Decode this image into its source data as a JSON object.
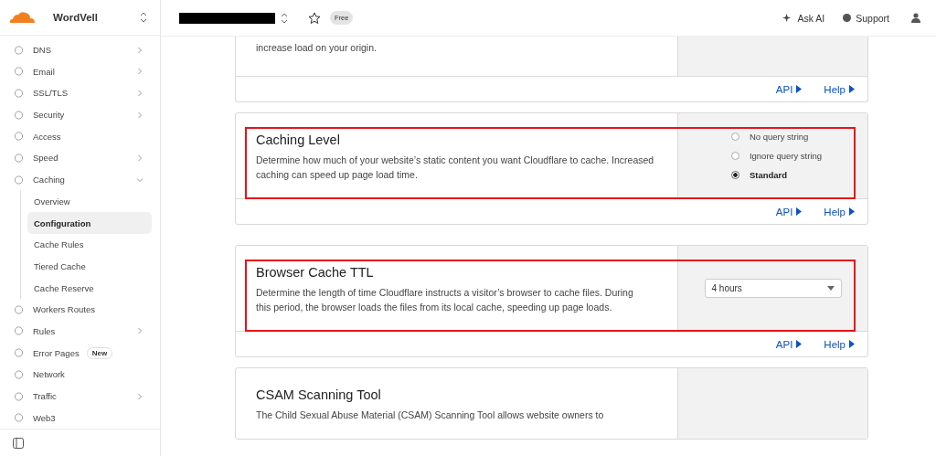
{
  "sidebar": {
    "account": "WordVell",
    "items": [
      {
        "label": "DNS",
        "expanded": false
      },
      {
        "label": "Email",
        "expanded": false
      },
      {
        "label": "SSL/TLS",
        "expanded": false
      },
      {
        "label": "Security",
        "expanded": false
      },
      {
        "label": "Access"
      },
      {
        "label": "Speed",
        "expanded": false
      },
      {
        "label": "Caching",
        "expanded": true,
        "children": [
          {
            "label": "Overview",
            "selected": false
          },
          {
            "label": "Configuration",
            "selected": true
          },
          {
            "label": "Cache Rules",
            "selected": false
          },
          {
            "label": "Tiered Cache",
            "selected": false
          },
          {
            "label": "Cache Reserve",
            "selected": false
          }
        ]
      },
      {
        "label": "Workers Routes"
      },
      {
        "label": "Rules",
        "expanded": false
      },
      {
        "label": "Error Pages",
        "badge": "New"
      },
      {
        "label": "Network"
      },
      {
        "label": "Traffic",
        "expanded": false
      },
      {
        "label": "Web3"
      }
    ]
  },
  "header": {
    "plan": "Free",
    "ask_ai": "Ask AI",
    "support": "Support"
  },
  "cards": [
    {
      "kind": "partial",
      "description": "increase load on your origin.",
      "highlighted": false,
      "links": [
        "API",
        "Help"
      ]
    },
    {
      "kind": "radio",
      "title": "Caching Level",
      "description": "Determine how much of your website’s static content you want Cloudflare to cache. Increased caching can speed up page load time.",
      "highlighted": true,
      "options": [
        {
          "label": "No query string",
          "selected": false
        },
        {
          "label": "Ignore query string",
          "selected": false
        },
        {
          "label": "Standard",
          "selected": true
        }
      ],
      "links": [
        "API",
        "Help"
      ]
    },
    {
      "kind": "select",
      "title": "Browser Cache TTL",
      "description": "Determine the length of time Cloudflare instructs a visitor’s browser to cache files. During this period, the browser loads the files from its local cache, speeding up page loads.",
      "highlighted": true,
      "value": "4 hours",
      "links": [
        "API",
        "Help"
      ]
    },
    {
      "kind": "cut",
      "title": "CSAM Scanning Tool",
      "description": "The Child Sexual Abuse Material (CSAM) Scanning Tool allows website owners to",
      "highlighted": false
    }
  ]
}
